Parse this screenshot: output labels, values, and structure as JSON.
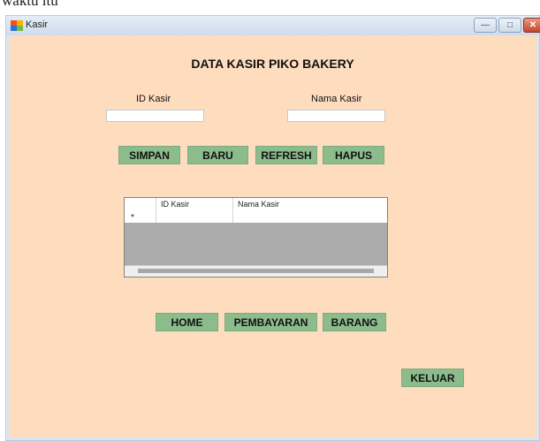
{
  "document": {
    "snippet_text": "waktu itu"
  },
  "window": {
    "title": "Kasir",
    "minimize_glyph": "—",
    "maximize_glyph": "□",
    "close_glyph": "✕"
  },
  "form": {
    "heading": "DATA KASIR PIKO BAKERY",
    "id_kasir_label": "ID Kasir",
    "id_kasir_value": "",
    "nama_kasir_label": "Nama Kasir",
    "nama_kasir_value": ""
  },
  "buttons": {
    "simpan": "SIMPAN",
    "baru": "BARU",
    "refresh": "REFRESH",
    "hapus": "HAPUS",
    "home": "HOME",
    "pembayaran": "PEMBAYARAN",
    "barang": "BARANG",
    "keluar": "KELUAR"
  },
  "grid": {
    "columns": [
      "ID Kasir",
      "Nama Kasir"
    ],
    "new_row_marker": "*"
  },
  "colors": {
    "background": "#fedcbe",
    "button": "#8cbc8c"
  },
  "icons": {
    "app": "app-window-icon"
  }
}
